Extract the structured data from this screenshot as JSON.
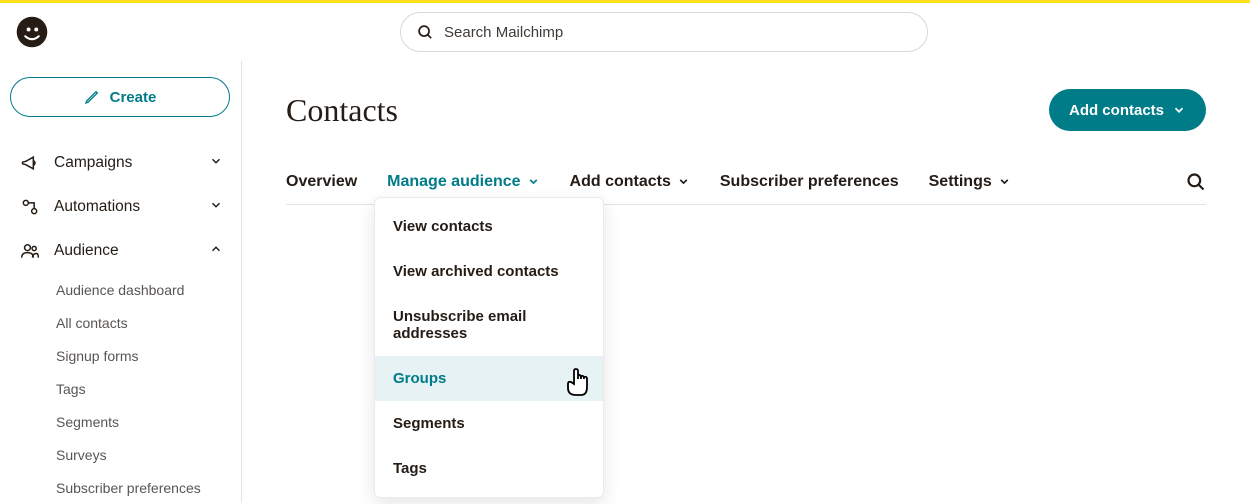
{
  "colors": {
    "accent": "#007c89",
    "highlight": "#ffe01b"
  },
  "search": {
    "placeholder": "Search Mailchimp"
  },
  "sidebar": {
    "create_label": "Create",
    "items": [
      {
        "label": "Campaigns"
      },
      {
        "label": "Automations"
      },
      {
        "label": "Audience"
      }
    ],
    "audience_sub": [
      {
        "label": "Audience dashboard"
      },
      {
        "label": "All contacts"
      },
      {
        "label": "Signup forms"
      },
      {
        "label": "Tags"
      },
      {
        "label": "Segments"
      },
      {
        "label": "Surveys"
      },
      {
        "label": "Subscriber preferences"
      }
    ]
  },
  "header": {
    "title": "Contacts",
    "add_contacts_label": "Add contacts"
  },
  "tabs": [
    {
      "label": "Overview"
    },
    {
      "label": "Manage audience"
    },
    {
      "label": "Add contacts"
    },
    {
      "label": "Subscriber preferences"
    },
    {
      "label": "Settings"
    }
  ],
  "manage_audience_menu": [
    {
      "label": "View contacts"
    },
    {
      "label": "View archived contacts"
    },
    {
      "label": "Unsubscribe email addresses"
    },
    {
      "label": "Groups"
    },
    {
      "label": "Segments"
    },
    {
      "label": "Tags"
    }
  ]
}
